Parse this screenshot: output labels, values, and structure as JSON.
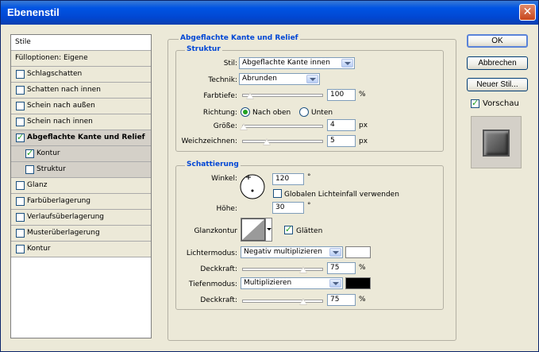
{
  "window": {
    "title": "Ebenenstil"
  },
  "icons": {
    "close": "close-icon"
  },
  "sidebar": {
    "header": "Stile",
    "blend_options": "Fülloptionen: Eigene",
    "items": [
      {
        "label": "Schlagschatten",
        "checked": false
      },
      {
        "label": "Schatten nach innen",
        "checked": false
      },
      {
        "label": "Schein nach außen",
        "checked": false
      },
      {
        "label": "Schein nach innen",
        "checked": false
      },
      {
        "label": "Abgeflachte Kante und Relief",
        "checked": true,
        "selected": true
      },
      {
        "label": "Kontur",
        "checked": true,
        "sub": true
      },
      {
        "label": "Struktur",
        "checked": false,
        "sub": true
      },
      {
        "label": "Glanz",
        "checked": false
      },
      {
        "label": "Farbüberlagerung",
        "checked": false
      },
      {
        "label": "Verlaufsüberlagerung",
        "checked": false
      },
      {
        "label": "Musterüberlagerung",
        "checked": false
      },
      {
        "label": "Kontur",
        "checked": false
      }
    ]
  },
  "main": {
    "section_title": "Abgeflachte Kante und Relief",
    "struktur": {
      "title": "Struktur",
      "stil_label": "Stil:",
      "stil_value": "Abgeflachte Kante innen",
      "technik_label": "Technik:",
      "technik_value": "Abrunden",
      "farbtiefe_label": "Farbtiefe:",
      "farbtiefe_value": "100",
      "farbtiefe_unit": "%",
      "farbtiefe_slider": 0.1,
      "richtung_label": "Richtung:",
      "nach_oben": "Nach oben",
      "unten": "Unten",
      "groesse_label": "Größe:",
      "groesse_value": "4",
      "groesse_unit": "px",
      "groesse_slider": 0.02,
      "weich_label": "Weichzeichnen:",
      "weich_value": "5",
      "weich_unit": "px",
      "weich_slider": 0.3
    },
    "schattierung": {
      "title": "Schattierung",
      "winkel_label": "Winkel:",
      "winkel_value": "120",
      "winkel_unit": "°",
      "global_label": "Globalen Lichteinfall verwenden",
      "global_checked": false,
      "hoehe_label": "Höhe:",
      "hoehe_value": "30",
      "hoehe_unit": "°",
      "glanz_label": "Glanzkontur",
      "glaetten_label": "Glätten",
      "glaetten_checked": true,
      "lichter_label": "Lichtermodus:",
      "lichter_value": "Negativ multiplizieren",
      "lichter_color": "#ffffff",
      "deck1_label": "Deckkraft:",
      "deck1_value": "75",
      "deck1_unit": "%",
      "deck1_slider": 0.75,
      "tiefen_label": "Tiefenmodus:",
      "tiefen_value": "Multiplizieren",
      "tiefen_color": "#000000",
      "deck2_label": "Deckkraft:",
      "deck2_value": "75",
      "deck2_unit": "%",
      "deck2_slider": 0.75
    }
  },
  "buttons": {
    "ok": "OK",
    "cancel": "Abbrechen",
    "new_style": "Neuer Stil...",
    "preview": "Vorschau",
    "preview_checked": true
  }
}
